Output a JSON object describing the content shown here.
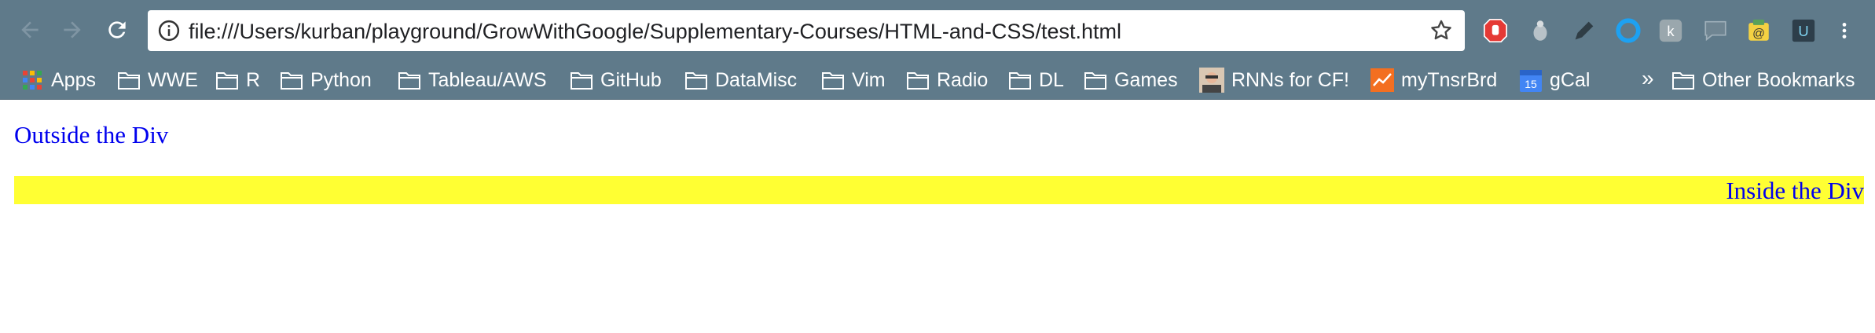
{
  "browser": {
    "url": "file:///Users/kurban/playground/GrowWithGoogle/Supplementary-Courses/HTML-and-CSS/test.html",
    "icons": {
      "back": "back-arrow-icon",
      "forward": "forward-arrow-icon",
      "reload": "reload-icon",
      "info": "info-icon",
      "star": "star-icon",
      "menu": "kebab-menu-icon"
    },
    "colors": {
      "chrome": "#5f7a8a",
      "link_text": "#0000ee",
      "div_background": "#ffff33"
    }
  },
  "bookmarks": {
    "items": [
      {
        "label": "Apps",
        "icon": "apps-grid-icon"
      },
      {
        "label": "WWE",
        "icon": "folder-icon"
      },
      {
        "label": "R",
        "icon": "folder-icon"
      },
      {
        "label": "Python",
        "icon": "folder-icon"
      },
      {
        "label": "Tableau/AWS",
        "icon": "folder-icon"
      },
      {
        "label": "GitHub",
        "icon": "folder-icon"
      },
      {
        "label": "DataMisc",
        "icon": "folder-icon"
      },
      {
        "label": "Vim",
        "icon": "folder-icon"
      },
      {
        "label": "Radio",
        "icon": "folder-icon"
      },
      {
        "label": "DL",
        "icon": "folder-icon"
      },
      {
        "label": "Games",
        "icon": "folder-icon"
      },
      {
        "label": "RNNs for CF!",
        "icon": "avatar-icon"
      },
      {
        "label": "myTnsrBrd",
        "icon": "chart-icon"
      },
      {
        "label": "gCal",
        "icon": "calendar-icon",
        "badge": "15"
      }
    ],
    "overflow": "»",
    "other": {
      "label": "Other Bookmarks",
      "icon": "folder-icon"
    }
  },
  "page": {
    "outside_text": "Outside the Div",
    "inside_text": "Inside the Div"
  }
}
